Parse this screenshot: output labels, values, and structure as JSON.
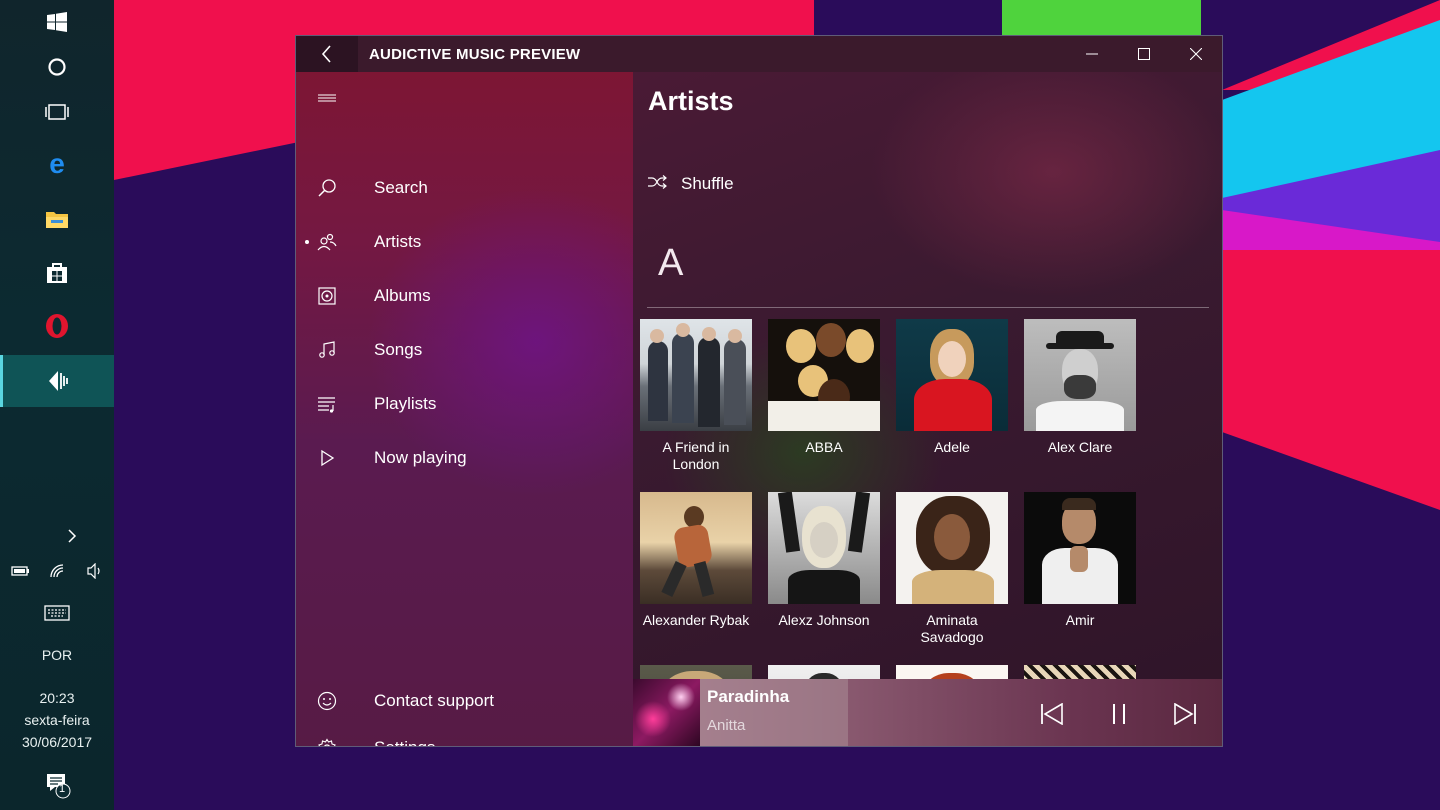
{
  "taskbar": {
    "icons": [
      "windows-start-icon",
      "cortana-icon",
      "task-view-icon",
      "edge-icon",
      "file-explorer-icon",
      "store-icon",
      "opera-icon",
      "audictive-icon"
    ],
    "language": "POR",
    "time": "20:23",
    "day": "sexta-feira",
    "date": "30/06/2017",
    "notification_count": "1"
  },
  "window": {
    "title": "AUDICTIVE MUSIC PREVIEW"
  },
  "sidebar": {
    "items": [
      {
        "label": "Search",
        "icon": "search-icon"
      },
      {
        "label": "Artists",
        "icon": "artists-icon",
        "active": true
      },
      {
        "label": "Albums",
        "icon": "albums-icon"
      },
      {
        "label": "Songs",
        "icon": "songs-icon"
      },
      {
        "label": "Playlists",
        "icon": "playlists-icon"
      },
      {
        "label": "Now playing",
        "icon": "play-icon"
      }
    ],
    "footer": [
      {
        "label": "Contact support",
        "icon": "smiley-icon"
      },
      {
        "label": "Settings",
        "icon": "gear-icon"
      }
    ]
  },
  "main": {
    "title": "Artists",
    "shuffle_label": "Shuffle",
    "section_letter": "A",
    "artists": [
      {
        "name": "A Friend in London"
      },
      {
        "name": "ABBA"
      },
      {
        "name": "Adele"
      },
      {
        "name": "Alex Clare"
      },
      {
        "name": "Alexander Rybak"
      },
      {
        "name": "Alexz Johnson"
      },
      {
        "name": "Aminata Savadogo"
      },
      {
        "name": "Amir"
      }
    ]
  },
  "now_playing": {
    "title": "Paradinha",
    "artist": "Anitta"
  },
  "colors": {
    "sidebar": "#741842",
    "titlebar": "#3b1a2c",
    "taskbar": "#0c2a31",
    "taskbar_active": "#0f5456"
  }
}
